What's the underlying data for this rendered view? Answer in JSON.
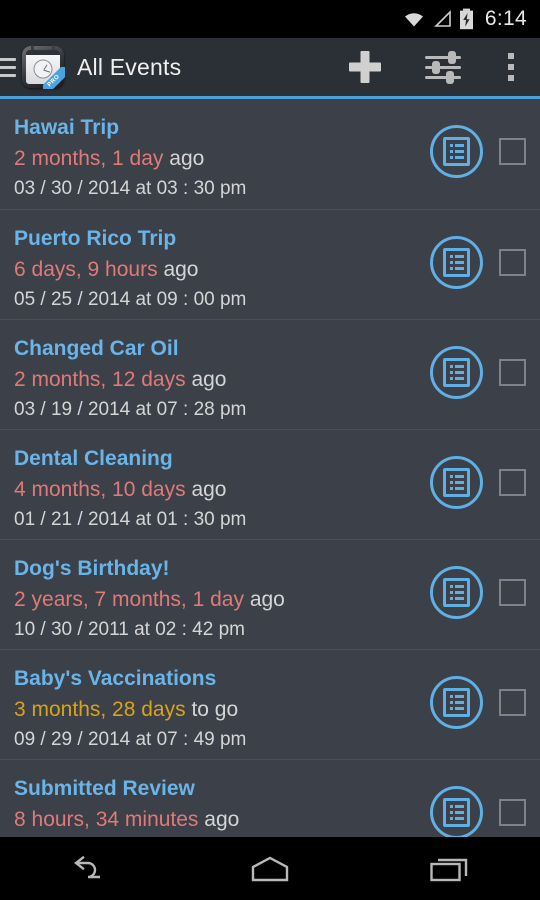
{
  "status_bar": {
    "time": "6:14",
    "icons": [
      "wifi-icon",
      "cell-signal-icon",
      "battery-charging-icon"
    ]
  },
  "action_bar": {
    "menu_icon": "hamburger-menu-icon",
    "app_icon": "app-logo-clock-calendar-icon",
    "app_badge": "PRO",
    "title": "All Events",
    "add_label": "add-event",
    "filter_label": "filter-settings",
    "overflow_label": "more-options",
    "accent_color": "#4a9fd8"
  },
  "colors": {
    "background": "#3b4049",
    "action_bar": "#2b2f36",
    "title_blue": "#6ab4e8",
    "past_red": "#e07a78",
    "future_amber": "#d8a316",
    "text_grey": "#d5d5d5",
    "divider": "#4a505a"
  },
  "events": [
    {
      "title": "Hawai Trip",
      "duration": "2 months, 1 day",
      "suffix": "ago",
      "tense": "past",
      "date": "03 / 30 / 2014 at 03 : 30 pm",
      "checked": false
    },
    {
      "title": "Puerto Rico Trip",
      "duration": "6 days, 9 hours",
      "suffix": "ago",
      "tense": "past",
      "date": "05 / 25 / 2014 at 09 : 00 pm",
      "checked": false
    },
    {
      "title": "Changed Car Oil",
      "duration": "2 months, 12 days",
      "suffix": "ago",
      "tense": "past",
      "date": "03 / 19 / 2014 at 07 : 28 pm",
      "checked": false
    },
    {
      "title": "Dental Cleaning",
      "duration": "4 months, 10 days",
      "suffix": "ago",
      "tense": "past",
      "date": "01 / 21 / 2014 at 01 : 30 pm",
      "checked": false
    },
    {
      "title": "Dog's Birthday!",
      "duration": "2 years, 7 months, 1 day",
      "suffix": "ago",
      "tense": "past",
      "date": "10 / 30 / 2011 at 02 : 42 pm",
      "checked": false
    },
    {
      "title": "Baby's Vaccinations",
      "duration": "3 months, 28 days",
      "suffix": "to go",
      "tense": "future",
      "date": "09 / 29 / 2014 at 07 : 49 pm",
      "checked": false
    },
    {
      "title": "Submitted Review",
      "duration": "8 hours, 34 minutes",
      "suffix": "ago",
      "tense": "past",
      "date": "",
      "checked": false
    }
  ],
  "nav_bar": {
    "back": "back-icon",
    "home": "home-icon",
    "recents": "recent-apps-icon"
  }
}
